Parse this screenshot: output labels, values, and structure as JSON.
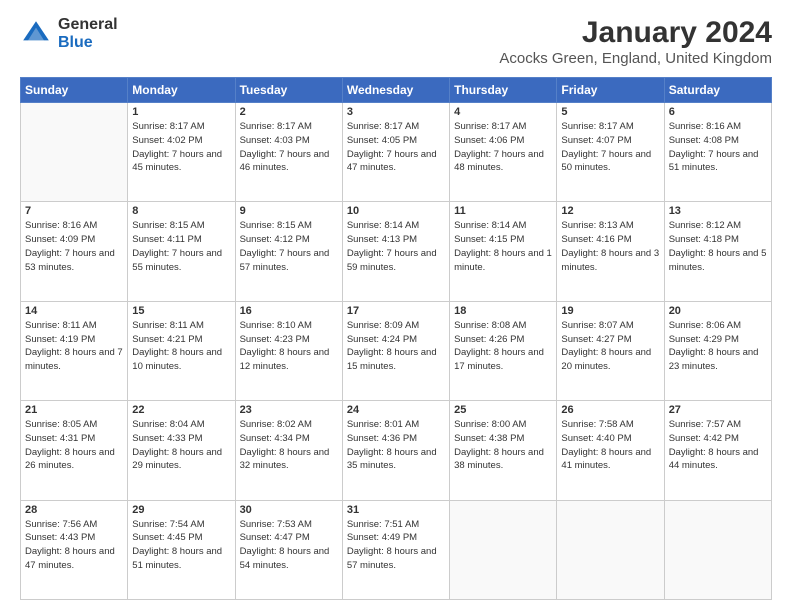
{
  "logo": {
    "general": "General",
    "blue": "Blue"
  },
  "title": "January 2024",
  "location": "Acocks Green, England, United Kingdom",
  "days_of_week": [
    "Sunday",
    "Monday",
    "Tuesday",
    "Wednesday",
    "Thursday",
    "Friday",
    "Saturday"
  ],
  "weeks": [
    [
      {
        "day": "",
        "sunrise": "",
        "sunset": "",
        "daylight": ""
      },
      {
        "day": "1",
        "sunrise": "Sunrise: 8:17 AM",
        "sunset": "Sunset: 4:02 PM",
        "daylight": "Daylight: 7 hours and 45 minutes."
      },
      {
        "day": "2",
        "sunrise": "Sunrise: 8:17 AM",
        "sunset": "Sunset: 4:03 PM",
        "daylight": "Daylight: 7 hours and 46 minutes."
      },
      {
        "day": "3",
        "sunrise": "Sunrise: 8:17 AM",
        "sunset": "Sunset: 4:05 PM",
        "daylight": "Daylight: 7 hours and 47 minutes."
      },
      {
        "day": "4",
        "sunrise": "Sunrise: 8:17 AM",
        "sunset": "Sunset: 4:06 PM",
        "daylight": "Daylight: 7 hours and 48 minutes."
      },
      {
        "day": "5",
        "sunrise": "Sunrise: 8:17 AM",
        "sunset": "Sunset: 4:07 PM",
        "daylight": "Daylight: 7 hours and 50 minutes."
      },
      {
        "day": "6",
        "sunrise": "Sunrise: 8:16 AM",
        "sunset": "Sunset: 4:08 PM",
        "daylight": "Daylight: 7 hours and 51 minutes."
      }
    ],
    [
      {
        "day": "7",
        "sunrise": "Sunrise: 8:16 AM",
        "sunset": "Sunset: 4:09 PM",
        "daylight": "Daylight: 7 hours and 53 minutes."
      },
      {
        "day": "8",
        "sunrise": "Sunrise: 8:15 AM",
        "sunset": "Sunset: 4:11 PM",
        "daylight": "Daylight: 7 hours and 55 minutes."
      },
      {
        "day": "9",
        "sunrise": "Sunrise: 8:15 AM",
        "sunset": "Sunset: 4:12 PM",
        "daylight": "Daylight: 7 hours and 57 minutes."
      },
      {
        "day": "10",
        "sunrise": "Sunrise: 8:14 AM",
        "sunset": "Sunset: 4:13 PM",
        "daylight": "Daylight: 7 hours and 59 minutes."
      },
      {
        "day": "11",
        "sunrise": "Sunrise: 8:14 AM",
        "sunset": "Sunset: 4:15 PM",
        "daylight": "Daylight: 8 hours and 1 minute."
      },
      {
        "day": "12",
        "sunrise": "Sunrise: 8:13 AM",
        "sunset": "Sunset: 4:16 PM",
        "daylight": "Daylight: 8 hours and 3 minutes."
      },
      {
        "day": "13",
        "sunrise": "Sunrise: 8:12 AM",
        "sunset": "Sunset: 4:18 PM",
        "daylight": "Daylight: 8 hours and 5 minutes."
      }
    ],
    [
      {
        "day": "14",
        "sunrise": "Sunrise: 8:11 AM",
        "sunset": "Sunset: 4:19 PM",
        "daylight": "Daylight: 8 hours and 7 minutes."
      },
      {
        "day": "15",
        "sunrise": "Sunrise: 8:11 AM",
        "sunset": "Sunset: 4:21 PM",
        "daylight": "Daylight: 8 hours and 10 minutes."
      },
      {
        "day": "16",
        "sunrise": "Sunrise: 8:10 AM",
        "sunset": "Sunset: 4:23 PM",
        "daylight": "Daylight: 8 hours and 12 minutes."
      },
      {
        "day": "17",
        "sunrise": "Sunrise: 8:09 AM",
        "sunset": "Sunset: 4:24 PM",
        "daylight": "Daylight: 8 hours and 15 minutes."
      },
      {
        "day": "18",
        "sunrise": "Sunrise: 8:08 AM",
        "sunset": "Sunset: 4:26 PM",
        "daylight": "Daylight: 8 hours and 17 minutes."
      },
      {
        "day": "19",
        "sunrise": "Sunrise: 8:07 AM",
        "sunset": "Sunset: 4:27 PM",
        "daylight": "Daylight: 8 hours and 20 minutes."
      },
      {
        "day": "20",
        "sunrise": "Sunrise: 8:06 AM",
        "sunset": "Sunset: 4:29 PM",
        "daylight": "Daylight: 8 hours and 23 minutes."
      }
    ],
    [
      {
        "day": "21",
        "sunrise": "Sunrise: 8:05 AM",
        "sunset": "Sunset: 4:31 PM",
        "daylight": "Daylight: 8 hours and 26 minutes."
      },
      {
        "day": "22",
        "sunrise": "Sunrise: 8:04 AM",
        "sunset": "Sunset: 4:33 PM",
        "daylight": "Daylight: 8 hours and 29 minutes."
      },
      {
        "day": "23",
        "sunrise": "Sunrise: 8:02 AM",
        "sunset": "Sunset: 4:34 PM",
        "daylight": "Daylight: 8 hours and 32 minutes."
      },
      {
        "day": "24",
        "sunrise": "Sunrise: 8:01 AM",
        "sunset": "Sunset: 4:36 PM",
        "daylight": "Daylight: 8 hours and 35 minutes."
      },
      {
        "day": "25",
        "sunrise": "Sunrise: 8:00 AM",
        "sunset": "Sunset: 4:38 PM",
        "daylight": "Daylight: 8 hours and 38 minutes."
      },
      {
        "day": "26",
        "sunrise": "Sunrise: 7:58 AM",
        "sunset": "Sunset: 4:40 PM",
        "daylight": "Daylight: 8 hours and 41 minutes."
      },
      {
        "day": "27",
        "sunrise": "Sunrise: 7:57 AM",
        "sunset": "Sunset: 4:42 PM",
        "daylight": "Daylight: 8 hours and 44 minutes."
      }
    ],
    [
      {
        "day": "28",
        "sunrise": "Sunrise: 7:56 AM",
        "sunset": "Sunset: 4:43 PM",
        "daylight": "Daylight: 8 hours and 47 minutes."
      },
      {
        "day": "29",
        "sunrise": "Sunrise: 7:54 AM",
        "sunset": "Sunset: 4:45 PM",
        "daylight": "Daylight: 8 hours and 51 minutes."
      },
      {
        "day": "30",
        "sunrise": "Sunrise: 7:53 AM",
        "sunset": "Sunset: 4:47 PM",
        "daylight": "Daylight: 8 hours and 54 minutes."
      },
      {
        "day": "31",
        "sunrise": "Sunrise: 7:51 AM",
        "sunset": "Sunset: 4:49 PM",
        "daylight": "Daylight: 8 hours and 57 minutes."
      },
      {
        "day": "",
        "sunrise": "",
        "sunset": "",
        "daylight": ""
      },
      {
        "day": "",
        "sunrise": "",
        "sunset": "",
        "daylight": ""
      },
      {
        "day": "",
        "sunrise": "",
        "sunset": "",
        "daylight": ""
      }
    ]
  ]
}
